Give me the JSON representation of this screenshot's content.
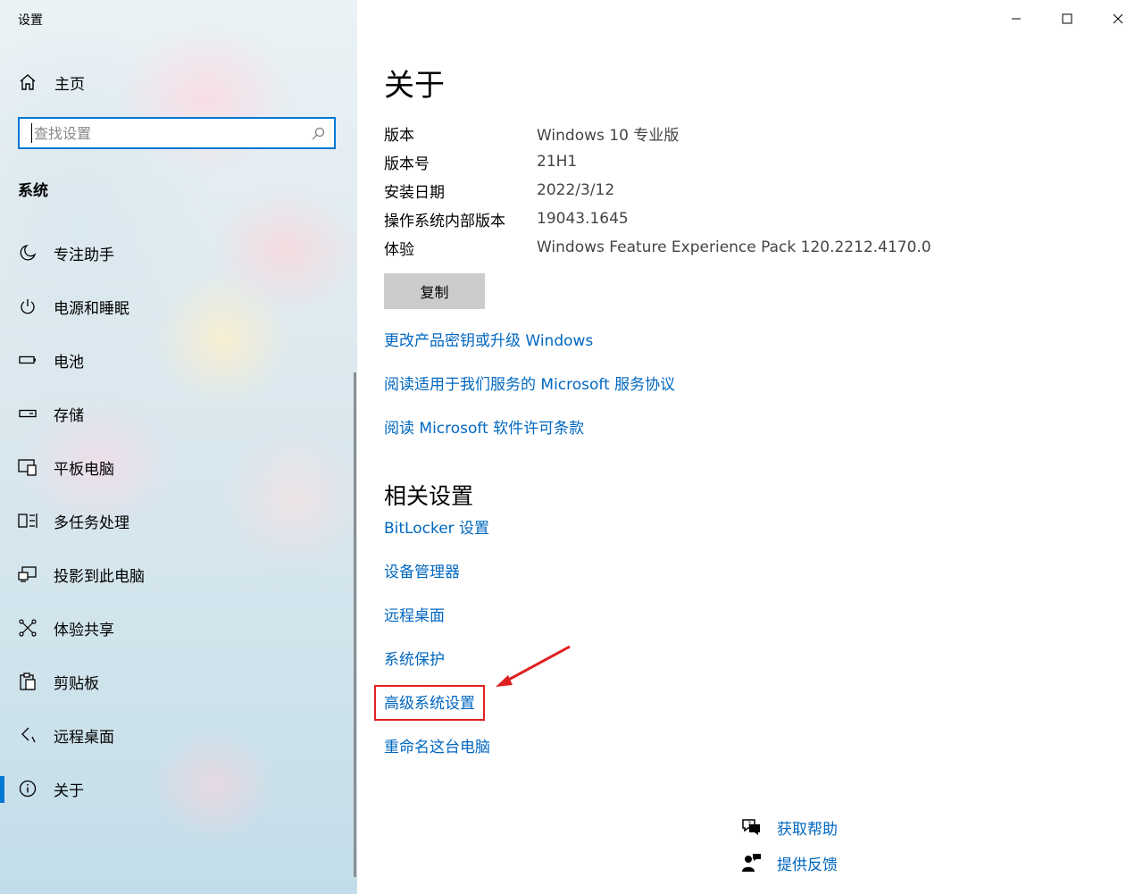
{
  "window": {
    "title": "设置"
  },
  "sidebar": {
    "home_label": "主页",
    "search_placeholder": "查找设置",
    "section": "系统",
    "items": [
      {
        "label": "专注助手",
        "icon": "moon-icon"
      },
      {
        "label": "电源和睡眠",
        "icon": "power-icon"
      },
      {
        "label": "电池",
        "icon": "battery-icon"
      },
      {
        "label": "存储",
        "icon": "storage-icon"
      },
      {
        "label": "平板电脑",
        "icon": "tablet-icon"
      },
      {
        "label": "多任务处理",
        "icon": "multitask-icon"
      },
      {
        "label": "投影到此电脑",
        "icon": "project-icon"
      },
      {
        "label": "体验共享",
        "icon": "share-icon"
      },
      {
        "label": "剪贴板",
        "icon": "clipboard-icon"
      },
      {
        "label": "远程桌面",
        "icon": "remote-icon"
      },
      {
        "label": "关于",
        "icon": "info-icon",
        "selected": true
      }
    ]
  },
  "main": {
    "title": "关于",
    "spec": [
      {
        "key": "版本",
        "value": "Windows 10 专业版"
      },
      {
        "key": "版本号",
        "value": "21H1"
      },
      {
        "key": "安装日期",
        "value": "2022/3/12"
      },
      {
        "key": "操作系统内部版本",
        "value": "19043.1645"
      },
      {
        "key": "体验",
        "value": "Windows Feature Experience Pack 120.2212.4170.0"
      }
    ],
    "copy_label": "复制",
    "links": [
      "更改产品密钥或升级 Windows",
      "阅读适用于我们服务的 Microsoft 服务协议",
      "阅读 Microsoft 软件许可条款"
    ],
    "related_title": "相关设置",
    "related_links": [
      "BitLocker 设置",
      "设备管理器",
      "远程桌面",
      "系统保护",
      "高级系统设置",
      "重命名这台电脑"
    ],
    "help_links": [
      {
        "label": "获取帮助",
        "icon": "help-chat-icon"
      },
      {
        "label": "提供反馈",
        "icon": "feedback-icon"
      }
    ]
  },
  "colors": {
    "accent": "#0078d4",
    "link": "#0067c0",
    "highlight": "#e02020"
  }
}
